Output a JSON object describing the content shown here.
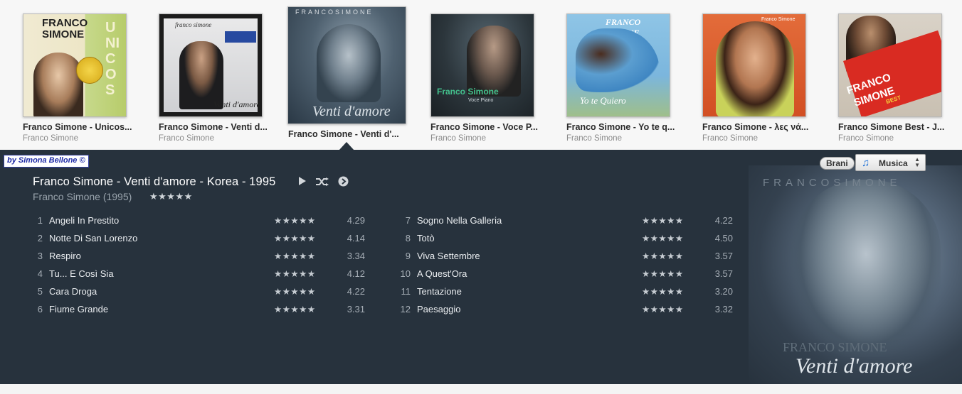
{
  "albums": [
    {
      "title": "Franco Simone - Unicos...",
      "artist": "Franco Simone",
      "cover_text": [
        "FRANCO",
        "SIMONE",
        "UNICOS"
      ]
    },
    {
      "title": "Franco Simone - Venti d...",
      "artist": "Franco Simone",
      "cover_text": [
        "franco simone",
        "Venti d'amore"
      ]
    },
    {
      "title": "Franco Simone - Venti d'...",
      "artist": "",
      "cover_text": [
        "FRANCOSIMONE",
        "Venti d'amore"
      ],
      "selected": true
    },
    {
      "title": "Franco Simone - Voce P...",
      "artist": "Franco Simone",
      "cover_text": [
        "Franco Simone",
        "Voce Piano"
      ]
    },
    {
      "title": "Franco Simone - Yo te q...",
      "artist": "Franco Simone",
      "cover_text": [
        "FRANCO SIMONE",
        "Yo te Quiero"
      ]
    },
    {
      "title": "Franco Simone - λες νά...",
      "artist": "Franco Simone",
      "cover_text": [
        "Franco Simone"
      ]
    },
    {
      "title": "Franco Simone Best - J...",
      "artist": "Franco Simone",
      "cover_text": [
        "FRANCO",
        "SIMONE",
        "BEST"
      ]
    }
  ],
  "credit": "by Simona Bellone ©",
  "detail": {
    "title": "Franco Simone - Venti d'amore - Korea - 1995",
    "artist_year": "Franco Simone (1995)",
    "album_rating": "★★★★★",
    "icons": [
      "play-icon",
      "shuffle-icon",
      "next-arrow-icon"
    ],
    "art_text": [
      "FRANCOSIMONE",
      "FRANCO SIMONE",
      "Venti d'amore"
    ]
  },
  "tracks_left": [
    {
      "num": "1",
      "name": "Angeli In Prestito",
      "stars": "★★★★★",
      "score": "4.29"
    },
    {
      "num": "2",
      "name": "Notte Di San Lorenzo",
      "stars": "★★★★★",
      "score": "4.14"
    },
    {
      "num": "3",
      "name": "Respiro",
      "stars": "★★★★★",
      "score": "3.34"
    },
    {
      "num": "4",
      "name": "Tu... E Così Sia",
      "stars": "★★★★★",
      "score": "4.12"
    },
    {
      "num": "5",
      "name": "Cara Droga",
      "stars": "★★★★★",
      "score": "4.22"
    },
    {
      "num": "6",
      "name": "Fiume Grande",
      "stars": "★★★★★",
      "score": "3.31"
    }
  ],
  "tracks_right": [
    {
      "num": "7",
      "name": "Sogno Nella Galleria",
      "stars": "★★★★★",
      "score": "4.22"
    },
    {
      "num": "8",
      "name": "Totò",
      "stars": "★★★★★",
      "score": "4.50"
    },
    {
      "num": "9",
      "name": "Viva Settembre",
      "stars": "★★★★★",
      "score": "3.57"
    },
    {
      "num": "10",
      "name": "A Quest'Ora",
      "stars": "★★★★★",
      "score": "3.57"
    },
    {
      "num": "11",
      "name": "Tentazione",
      "stars": "★★★★★",
      "score": "3.20"
    },
    {
      "num": "12",
      "name": "Paesaggio",
      "stars": "★★★★★",
      "score": "3.32"
    }
  ],
  "controls": {
    "brani_label": "Brani",
    "musica_label": "Musica"
  },
  "colors": {
    "panel_bg": "#27323d",
    "strip_bg": "#f7f7f7",
    "accent_note": "#1c6fd6"
  }
}
